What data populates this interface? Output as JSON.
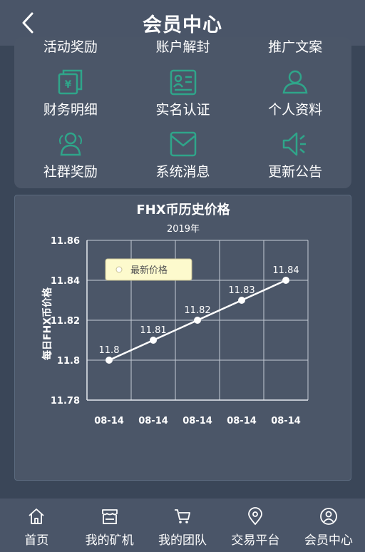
{
  "header": {
    "title": "会员中心"
  },
  "menu": {
    "cut_labels": [
      "活动奖励",
      "账户解封",
      "推广文案"
    ],
    "items": [
      {
        "label": "财务明细",
        "icon": "finance-icon"
      },
      {
        "label": "实名认证",
        "icon": "id-card-icon"
      },
      {
        "label": "个人资料",
        "icon": "user-icon"
      },
      {
        "label": "社群奖励",
        "icon": "group-icon"
      },
      {
        "label": "系统消息",
        "icon": "mail-icon"
      },
      {
        "label": "更新公告",
        "icon": "speaker-icon"
      }
    ],
    "icon_color": "#2fa58a"
  },
  "chart_data": {
    "type": "line",
    "title": "FHX币历史价格",
    "subtitle": "2019年",
    "ylabel": "每日FHX币价格",
    "xlabel": "",
    "categories": [
      "08-14",
      "08-14",
      "08-14",
      "08-14",
      "08-14"
    ],
    "series": [
      {
        "name": "最新价格",
        "values": [
          11.8,
          11.81,
          11.82,
          11.83,
          11.84
        ]
      }
    ],
    "point_labels": [
      "11.8",
      "11.81",
      "11.82",
      "11.83",
      "11.84"
    ],
    "y_ticks": [
      "11.78",
      "11.8",
      "11.82",
      "11.84",
      "11.86"
    ],
    "ylim": [
      11.78,
      11.86
    ],
    "grid": true,
    "legend_position": "top-left",
    "line_color": "#ffffff",
    "legend_bg": "#fdfacd"
  },
  "tabbar": {
    "items": [
      {
        "label": "首页",
        "icon": "home-icon"
      },
      {
        "label": "我的矿机",
        "icon": "store-icon"
      },
      {
        "label": "我的团队",
        "icon": "cart-icon"
      },
      {
        "label": "交易平台",
        "icon": "location-icon"
      },
      {
        "label": "会员中心",
        "icon": "profile-icon"
      }
    ]
  }
}
